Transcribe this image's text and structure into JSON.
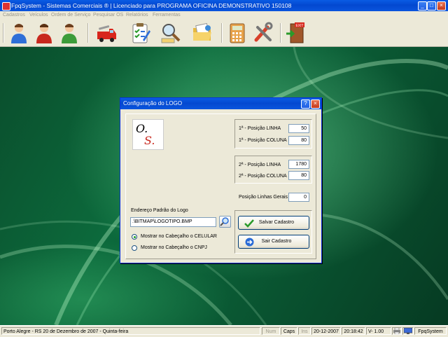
{
  "window": {
    "title": "FpqSystem - Sistemas Comerciais ®  | Licenciado para  PROGRAMA OFICINA DEMONSTRATIVO 150108",
    "buttons": {
      "minimize": "_",
      "maximize": "□",
      "close": "×"
    }
  },
  "menu": [
    "Cadastros",
    "Veículos",
    "Ordem de Serviço",
    "Pesquisar OS",
    "Relatórios",
    "Ferramentas"
  ],
  "toolbar": {
    "icons": [
      "user-blue-icon",
      "user-red-icon",
      "user-green-icon",
      "fire-truck-icon",
      "checklist-icon",
      "search-magnifier-icon",
      "open-folder-icon",
      "calculator-icon",
      "tools-icon",
      "exit-door-icon"
    ],
    "exit_sign": "EXIT"
  },
  "dialog": {
    "title": "Configuração do LOGO",
    "help_button": "?",
    "close_button": "×",
    "logo": {
      "letter1": "O.",
      "letter2": "S."
    },
    "pos1_linha_label": "1ª - Posição LINHA",
    "pos1_linha_value": "50",
    "pos1_coluna_label": "1ª - Posição COLUNA",
    "pos1_coluna_value": "80",
    "pos2_linha_label": "2ª - Posição LINHA",
    "pos2_linha_value": "1780",
    "pos2_coluna_label": "2ª - Posição COLUNA",
    "pos2_coluna_value": "80",
    "linhas_gerais_label": "Posição Linhas Gerais",
    "linhas_gerais_value": "0",
    "endereco_label": "Endereço Padrão do Logo",
    "endereco_value": ".\\BITMAP\\LOGOTIPO.BMP",
    "radio_celular": "Mostrar no Cabeçalho o CELULAR",
    "radio_cnpj": "Mostrar no Cabeçalho o CNPJ",
    "radio_selected": "celular",
    "save_button": "Salvar Cadastro",
    "exit_button": "Sair Cadastro"
  },
  "statusbar": {
    "location_date": "Porto Alegre - RS 20 de Dezembro de 2007 - Quinta-feira",
    "num": "Num",
    "caps": "Caps",
    "ins": "Ins",
    "date": "20-12-2007",
    "time": "20:18:42",
    "version": "V-  1.00",
    "app": "FpqSystem"
  },
  "colors": {
    "titlebar": "#0348d0",
    "window_face": "#ece9d8",
    "desktop": "#0c6a3c",
    "save_check": "#2a9a2a",
    "exit_arrow": "#2a6bd6"
  }
}
